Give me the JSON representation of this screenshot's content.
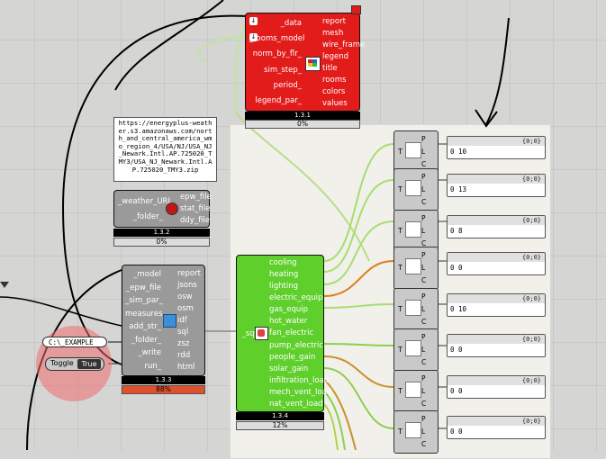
{
  "red_component": {
    "inputs": [
      "_data",
      "_rooms_model",
      "norm_by_flr_",
      "sim_step_",
      "period_",
      "legend_par_"
    ],
    "outputs": [
      "report",
      "mesh",
      "wire_frame",
      "legend",
      "title",
      "rooms",
      "colors",
      "values"
    ],
    "version": "1.3.1",
    "progress": "0%",
    "color": "#e21b1b"
  },
  "weather_panel": {
    "text": "https://energyplus-weather.s3.amazonaws.com/north_and_central_america_wmo_region_4/USA/NJ/USA_NJ_Newark.Intl.AP.725020_TMY3/USA_NJ_Newark.Intl.AP.725020_TMY3.zip"
  },
  "weather_component": {
    "inputs": [
      "_weather_URL",
      "_folder_"
    ],
    "outputs": [
      "epw_file",
      "stat_file",
      "ddy_file"
    ],
    "version": "1.3.2",
    "progress": "0%"
  },
  "model_component": {
    "inputs": [
      "_model",
      "_epw_file",
      "_sim_par_",
      "measures_",
      "add_str_",
      "_folder_",
      "_write",
      "run_"
    ],
    "outputs": [
      "report",
      "jsons",
      "osw",
      "osm",
      "idf",
      "sql",
      "zsz",
      "rdd",
      "html"
    ],
    "version": "1.3.3",
    "progress": "88%"
  },
  "path_pill": "C:\\_EXAMPLE",
  "toggle": {
    "label": "Toggle",
    "value": "True"
  },
  "green_component": {
    "input": "_sql",
    "outputs": [
      "cooling",
      "heating",
      "lighting",
      "electric_equip",
      "gas_equip",
      "hot_water",
      "fan_electric",
      "pump_electric",
      "people_gain",
      "solar_gain",
      "infiltration_load",
      "mech_vent_load",
      "nat_vent_load"
    ],
    "version": "1.3.4",
    "progress": "12%",
    "color": "#5fcf2c"
  },
  "param_nodes": {
    "t_label": "T",
    "plc": [
      "P",
      "L",
      "C"
    ]
  },
  "result_panels": [
    {
      "header": "{0;0}",
      "value": "0 10"
    },
    {
      "header": "{0;0}",
      "value": "0 13"
    },
    {
      "header": "{0;0}",
      "value": "0 8"
    },
    {
      "header": "{0;0}",
      "value": "0 0"
    },
    {
      "header": "{0;0}",
      "value": "0 10"
    },
    {
      "header": "{0;0}",
      "value": "0 0"
    },
    {
      "header": "{0;0}",
      "value": "0 0"
    },
    {
      "header": "{0;0}",
      "value": "0 0"
    }
  ]
}
